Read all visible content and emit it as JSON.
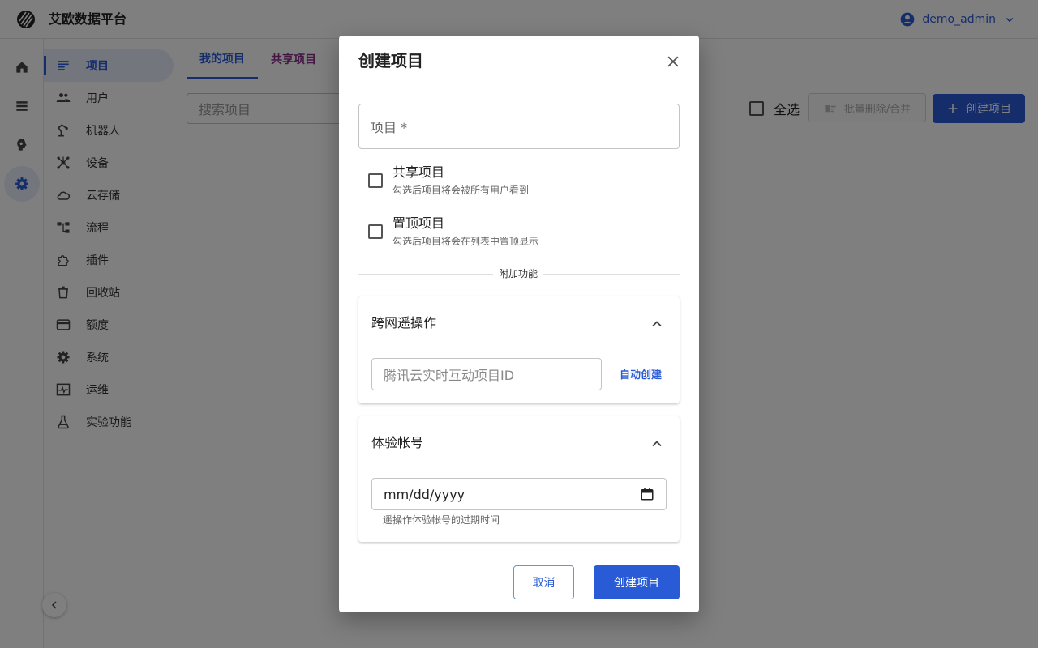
{
  "header": {
    "app_title": "艾欧数据平台",
    "username": "demo_admin"
  },
  "rail": {
    "items": [
      {
        "icon": "home-icon"
      },
      {
        "icon": "list-icon"
      },
      {
        "icon": "brain-icon"
      },
      {
        "icon": "settings-icon",
        "active": true
      }
    ]
  },
  "sidebar": {
    "items": [
      {
        "label": "项目",
        "icon": "project-list-icon",
        "active": true
      },
      {
        "label": "用户",
        "icon": "users-icon"
      },
      {
        "label": "机器人",
        "icon": "robot-arm-icon"
      },
      {
        "label": "设备",
        "icon": "device-hub-icon"
      },
      {
        "label": "云存储",
        "icon": "cloud-icon"
      },
      {
        "label": "流程",
        "icon": "workflow-icon"
      },
      {
        "label": "插件",
        "icon": "puzzle-icon"
      },
      {
        "label": "回收站",
        "icon": "trash-icon"
      },
      {
        "label": "额度",
        "icon": "credit-card-icon"
      },
      {
        "label": "系统",
        "icon": "gear-icon"
      },
      {
        "label": "运维",
        "icon": "monitoring-icon"
      },
      {
        "label": "实验功能",
        "icon": "flask-icon"
      }
    ]
  },
  "main": {
    "tabs": [
      {
        "label": "我的项目",
        "active": true
      },
      {
        "label": "共享项目"
      }
    ],
    "search_placeholder": "搜索项目",
    "select_all_label": "全选",
    "batch_delete_label": "批量删除/合并",
    "create_label": "创建项目"
  },
  "dialog": {
    "title": "创建项目",
    "project_name_label": "项目 *",
    "shared": {
      "title": "共享项目",
      "description": "勾选后项目将会被所有用户看到"
    },
    "pinned": {
      "title": "置顶项目",
      "description": "勾选后项目将会在列表中置顶显示"
    },
    "divider_label": "附加功能",
    "remote_panel": {
      "title": "跨网遥操作",
      "input_placeholder": "腾讯云实时互动项目ID",
      "auto_create_label": "自动创建"
    },
    "trial_panel": {
      "title": "体验帐号",
      "date_placeholder": "mm/dd/yyyy",
      "help_text": "遥操作体验帐号的过期时间"
    },
    "cancel_label": "取消",
    "submit_label": "创建项目"
  },
  "colors": {
    "primary": "#2a5bd7",
    "secondary_tab": "#8a2f8a",
    "overlay": "rgba(0,0,0,0.5)"
  }
}
